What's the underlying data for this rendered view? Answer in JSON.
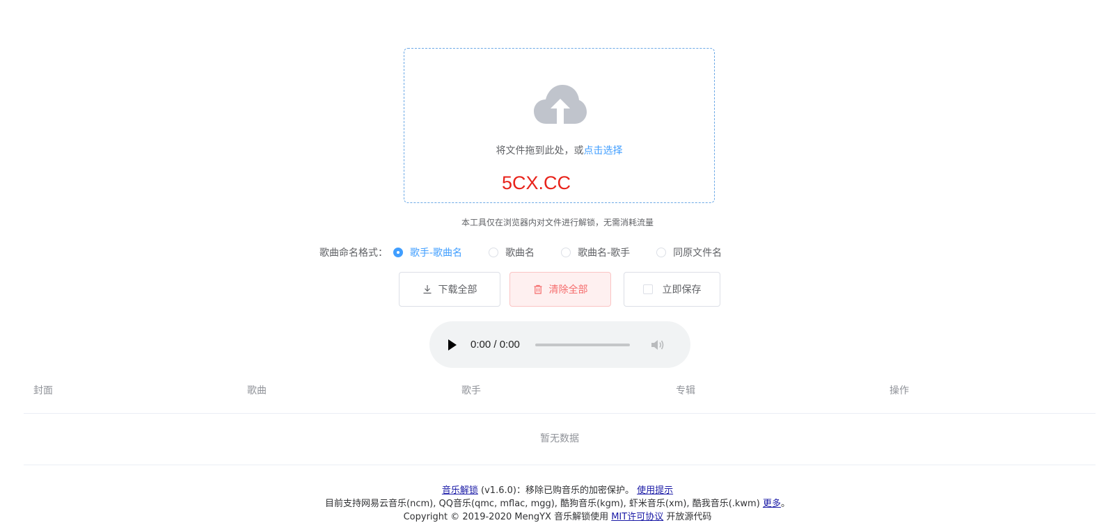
{
  "upload": {
    "text": "将文件拖到此处，或",
    "link": "点击选择",
    "watermark": "5CX.CC"
  },
  "tip": "本工具仅在浏览器内对文件进行解锁，无需消耗流量",
  "naming": {
    "label": "歌曲命名格式：",
    "options": [
      "歌手-歌曲名",
      "歌曲名",
      "歌曲名-歌手",
      "同原文件名"
    ],
    "selected": "歌手-歌曲名"
  },
  "actions": {
    "download_all": "下载全部",
    "clear_all": "清除全部",
    "save_now": "立即保存"
  },
  "player": {
    "time": "0:00 / 0:00",
    "progress": 0
  },
  "table": {
    "columns": [
      "封面",
      "歌曲",
      "歌手",
      "专辑",
      "操作"
    ],
    "empty_text": "暂无数据"
  },
  "footer": {
    "app_link": "音乐解锁",
    "app_desc": "(v1.6.0)：移除已购音乐的加密保护。",
    "usage_link": "使用提示",
    "support_text": "目前支持网易云音乐(ncm), QQ音乐(qmc, mflac, mgg), 酷狗音乐(kgm), 虾米音乐(xm), 酷我音乐(.kwm)",
    "more_link": "更多",
    "support_end": "。",
    "copyright": "Copyright © 2019-2020 MengYX 音乐解锁使用",
    "license_link": "MIT许可协议",
    "source_text": "开放源代码"
  },
  "colors": {
    "primary": "#409eff",
    "danger": "#f56c6c",
    "watermark": "#e8231b"
  }
}
